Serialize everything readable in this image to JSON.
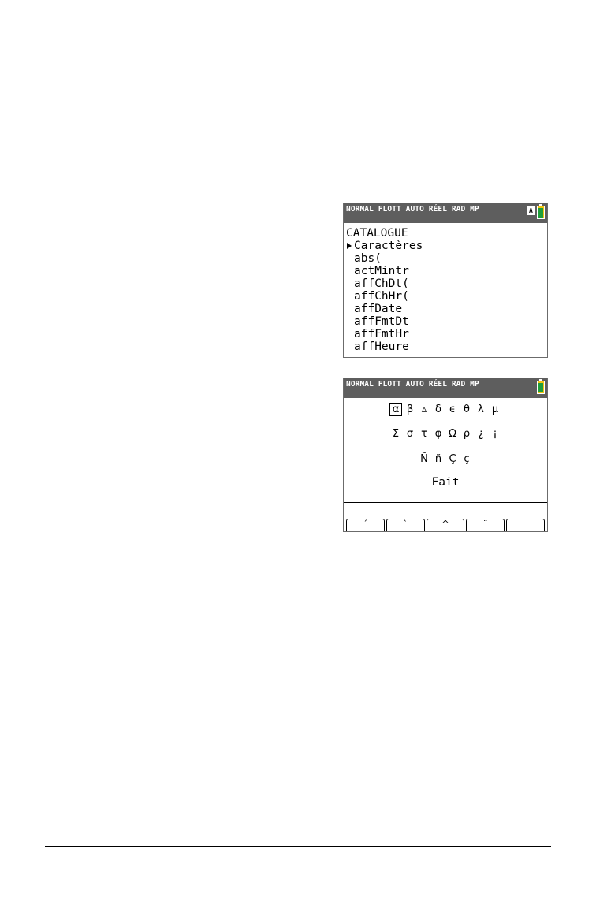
{
  "screen1": {
    "status": "NORMAL FLOTT AUTO RÉEL RAD MP",
    "alpha_badge": "A",
    "title": "CATALOGUE",
    "items": [
      "Caractères",
      "abs(",
      "actMintr",
      "affChDt(",
      "affChHr(",
      "affDate",
      "affFmtDt",
      "affFmtHr",
      "affHeure"
    ],
    "selected_index": 0
  },
  "screen2": {
    "status": "NORMAL FLOTT AUTO RÉEL RAD MP",
    "row1": [
      "α",
      "β",
      "▵",
      "δ",
      "ϵ",
      "θ",
      "λ",
      "μ"
    ],
    "row2": [
      "Σ",
      "σ",
      "τ",
      "φ",
      "Ω",
      "ρ",
      "¿",
      "¡"
    ],
    "row3": [
      "Ñ",
      "ñ",
      "Ç",
      "ç"
    ],
    "done_label": "Fait",
    "softkeys": [
      "´",
      "`",
      "^",
      "¨",
      ""
    ]
  },
  "colors": {
    "status_bg": "#5e5e5e",
    "battery_fill": "#1f9e3a",
    "battery_top": "#f1c40f"
  }
}
